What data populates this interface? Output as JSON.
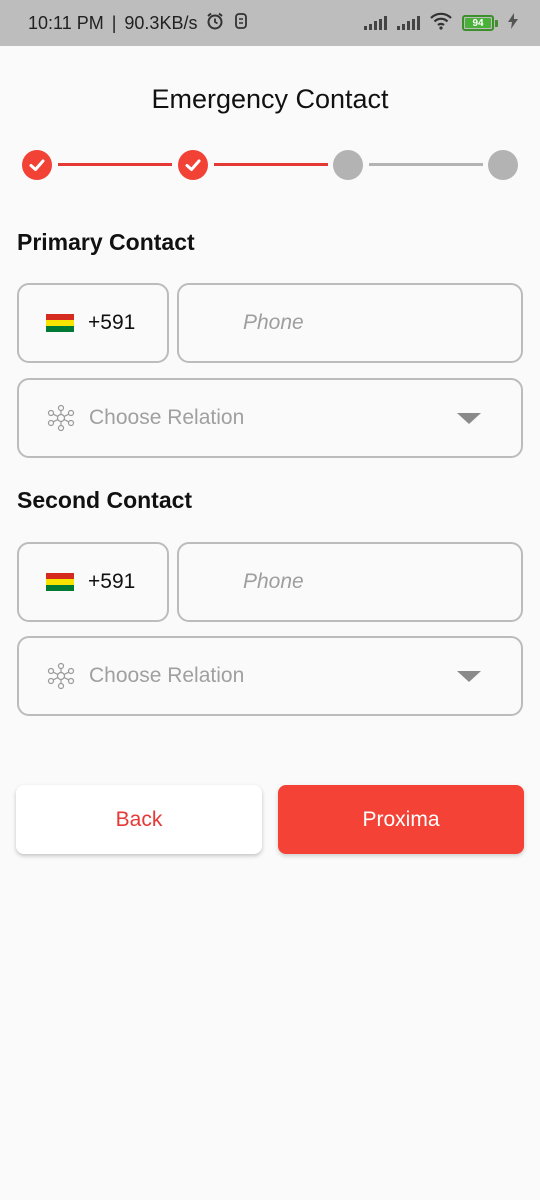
{
  "status_bar": {
    "time": "10:11 PM",
    "speed": "90.3KB/s",
    "battery": "94",
    "icons": [
      "alarm-icon",
      "app-notification-icon",
      "signal-icon",
      "signal-icon",
      "wifi-icon",
      "battery-icon",
      "charging-icon"
    ]
  },
  "page": {
    "title": "Emergency Contact"
  },
  "stepper": {
    "steps": [
      "done",
      "done",
      "todo",
      "todo"
    ]
  },
  "primary": {
    "title": "Primary Contact",
    "country_code": "+591",
    "phone_placeholder": "Phone",
    "relation_placeholder": "Choose Relation"
  },
  "second": {
    "title": "Second Contact",
    "country_code": "+591",
    "phone_placeholder": "Phone",
    "relation_placeholder": "Choose Relation"
  },
  "buttons": {
    "back": "Back",
    "next": "Proxima"
  },
  "colors": {
    "accent": "#f44336",
    "inactive": "#b3b3b3",
    "border": "#bcbcbc",
    "flag_bolivia": [
      "#d52b1e",
      "#f9e300",
      "#007934"
    ]
  }
}
